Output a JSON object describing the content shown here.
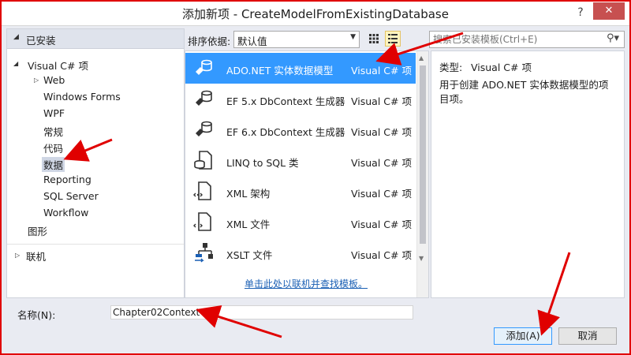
{
  "window": {
    "title": "添加新项 - CreateModelFromExistingDatabase",
    "help_glyph": "?",
    "close_glyph": "✕"
  },
  "left_pane": {
    "installed_label": "已安装",
    "tree": [
      {
        "label": "Visual C# 项",
        "level": 0,
        "expanded": true
      },
      {
        "label": "Web",
        "level": 1,
        "collapsed_children": true
      },
      {
        "label": "Windows Forms",
        "level": 1
      },
      {
        "label": "WPF",
        "level": 1
      },
      {
        "label": "常规",
        "level": 1
      },
      {
        "label": "代码",
        "level": 1
      },
      {
        "label": "数据",
        "level": 1,
        "selected": true
      },
      {
        "label": "Reporting",
        "level": 1
      },
      {
        "label": "SQL Server",
        "level": 1
      },
      {
        "label": "Workflow",
        "level": 1
      },
      {
        "label": "图形",
        "level": 0
      }
    ],
    "online_label": "联机"
  },
  "toolbar": {
    "sort_label": "排序依据:",
    "sort_value": "默认值",
    "search_placeholder": "搜索已安装模板(Ctrl+E)"
  },
  "templates": [
    {
      "name": "ADO.NET 实体数据模型",
      "type": "Visual C# 项",
      "icon": "entity-model-icon",
      "selected": true
    },
    {
      "name": "EF 5.x DbContext 生成器",
      "type": "Visual C# 项",
      "icon": "dbcontext-generator-icon"
    },
    {
      "name": "EF 6.x DbContext 生成器",
      "type": "Visual C# 项",
      "icon": "dbcontext-generator-icon"
    },
    {
      "name": "LINQ to SQL 类",
      "type": "Visual C# 项",
      "icon": "linq-to-sql-icon"
    },
    {
      "name": "XML 架构",
      "type": "Visual C# 项",
      "icon": "xml-schema-icon"
    },
    {
      "name": "XML 文件",
      "type": "Visual C# 项",
      "icon": "xml-file-icon"
    },
    {
      "name": "XSLT 文件",
      "type": "Visual C# 项",
      "icon": "xslt-file-icon"
    }
  ],
  "online_link": "单击此处以联机并查找模板。",
  "description": {
    "type_label": "类型:",
    "type_value": "Visual C# 项",
    "text": "用于创建 ADO.NET 实体数据模型的项目项。"
  },
  "name_field": {
    "label": "名称(N):",
    "value": "Chapter02Context"
  },
  "buttons": {
    "add": "添加(A)",
    "cancel": "取消"
  },
  "colors": {
    "annotation_arrow": "#e00000",
    "selection": "#3399ff",
    "link": "#1a5fb4"
  }
}
